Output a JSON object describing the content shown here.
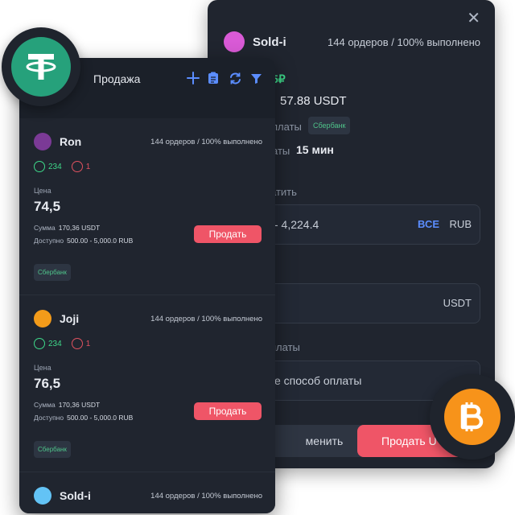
{
  "colors": {
    "panel_bg": "#20252f",
    "accent_blue": "#5b8dff",
    "sell_red": "#ef5567",
    "positive_green": "#3ed98a",
    "negative_red": "#e05260",
    "usdt_green": "#26a17b",
    "btc_orange": "#f7931a"
  },
  "back_panel": {
    "close_icon": "close-icon",
    "seller_name": "Sold-i",
    "seller_color": "#d95ad6",
    "seller_stats": "144 ордеров / 100% выполнено",
    "rate_fragment": "5₽",
    "limit_value": "57.88 USDT",
    "payment_label_fragment": "платы",
    "bank_tag": "Сбербанк",
    "time_label_fragment": "аты",
    "time_value": "15 мин",
    "want_pay_label_fragment": "атить",
    "amount_field": {
      "value_fragment": "- 4,224.4",
      "all_label": "ВСЕ",
      "currency": "RUB"
    },
    "receive_field": {
      "currency": "USDT"
    },
    "method_label_fragment": "платы",
    "method_field": {
      "placeholder_fragment": "е способ оплаты"
    },
    "cancel_button_fragment": "менить",
    "sell_button_fragment": "Продать U"
  },
  "front_panel": {
    "title": "Продажа",
    "header_icons": [
      "plus-icon",
      "clipboard-icon",
      "refresh-icon",
      "filter-icon"
    ],
    "labels": {
      "price": "Цена",
      "sum": "Сумма",
      "available": "Доступно",
      "sell": "Продать"
    },
    "offers": [
      {
        "name": "Ron",
        "avatar_color": "#7b3a96",
        "stats": "144 ордеров / 100% выполнено",
        "positive": "234",
        "negative": "1",
        "price": "74,5",
        "sum": "170,36  USDT",
        "available": "500.00 - 5,000.0  RUB",
        "bank": "Сбербанк"
      },
      {
        "name": "Joji",
        "avatar_color": "#f39b1a",
        "stats": "144 ордеров / 100% выполнено",
        "positive": "234",
        "negative": "1",
        "price": "76,5",
        "sum": "170,36  USDT",
        "available": "500.00 - 5,000.0  RUB",
        "bank": "Сбербанк"
      },
      {
        "name": "Sold-i",
        "avatar_color": "#63c3f5",
        "stats": "144 ордеров / 100% выполнено"
      }
    ]
  },
  "logos": {
    "usdt": "tether-logo",
    "btc": "bitcoin-logo"
  }
}
